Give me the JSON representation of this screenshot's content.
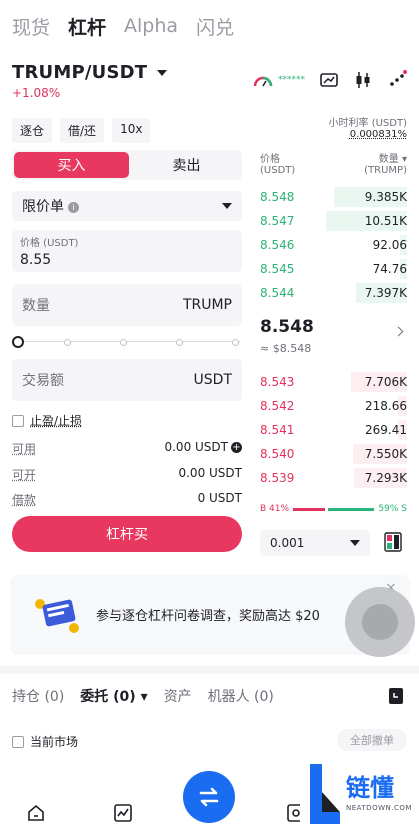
{
  "top_tabs": [
    "现货",
    "杠杆",
    "Alpha",
    "闪兑"
  ],
  "pair": {
    "name": "TRUMP/USDT",
    "change": "+1.08%",
    "stars": "******"
  },
  "chips": [
    "逐仓",
    "借/还",
    "10x"
  ],
  "rate": {
    "label": "小时利率 (USDT)",
    "value": "0.000831%"
  },
  "side": {
    "buy": "买入",
    "sell": "卖出"
  },
  "order_type": "限价单",
  "price": {
    "label": "价格 (USDT)",
    "value": "8.55"
  },
  "quantity": {
    "label": "数量",
    "unit": "TRUMP"
  },
  "amount": {
    "label": "交易额",
    "unit": "USDT"
  },
  "tpsl": "止盈/止损",
  "available": {
    "label": "可用",
    "value": "0.00 USDT"
  },
  "openable": {
    "label": "可开",
    "value": "0.00 USDT"
  },
  "borrowed": {
    "label": "借款",
    "value": "0 USDT"
  },
  "buy_button": "杠杆买",
  "orderbook": {
    "price_head": "价格",
    "price_unit": "(USDT)",
    "qty_head": "数量",
    "qty_unit": "(TRUMP)",
    "bids_top": [
      {
        "price": "8.548",
        "qty": "9.385K",
        "depth": 0.5
      },
      {
        "price": "8.547",
        "qty": "10.51K",
        "depth": 0.55
      },
      {
        "price": "8.546",
        "qty": "92.06",
        "depth": 0.05
      },
      {
        "price": "8.545",
        "qty": "74.76",
        "depth": 0.05
      },
      {
        "price": "8.544",
        "qty": "7.397K",
        "depth": 0.35
      }
    ],
    "mid": "8.548",
    "mid_fiat": "≈ $8.548",
    "asks_bottom": [
      {
        "price": "8.543",
        "qty": "7.706K",
        "depth": 0.38
      },
      {
        "price": "8.542",
        "qty": "218.66",
        "depth": 0.06
      },
      {
        "price": "8.541",
        "qty": "269.41",
        "depth": 0.06
      },
      {
        "price": "8.540",
        "qty": "7.550K",
        "depth": 0.37
      },
      {
        "price": "8.539",
        "qty": "7.293K",
        "depth": 0.36
      }
    ],
    "ratio_buy": "B 41%",
    "ratio_sell": "59% S",
    "buy_fraction": 0.41,
    "step": "0.001"
  },
  "banner": {
    "text": "参与逐仓杠杆问卷调查，奖励高达 $20",
    "close": "×"
  },
  "bottom_tabs": {
    "positions": "持仓 (0)",
    "orders": "委托 (0)",
    "assets": "资产",
    "robots": "机器人 (0)"
  },
  "current_market": "当前市场",
  "cancel_all": "全部撤单",
  "watermark": {
    "title": "链懂",
    "sub": "NEATDOWN.COM"
  },
  "colors": {
    "accent_buy": "#e8385f",
    "up": "#2bb479",
    "down": "#e0325c",
    "fab": "#1a6cf0"
  }
}
